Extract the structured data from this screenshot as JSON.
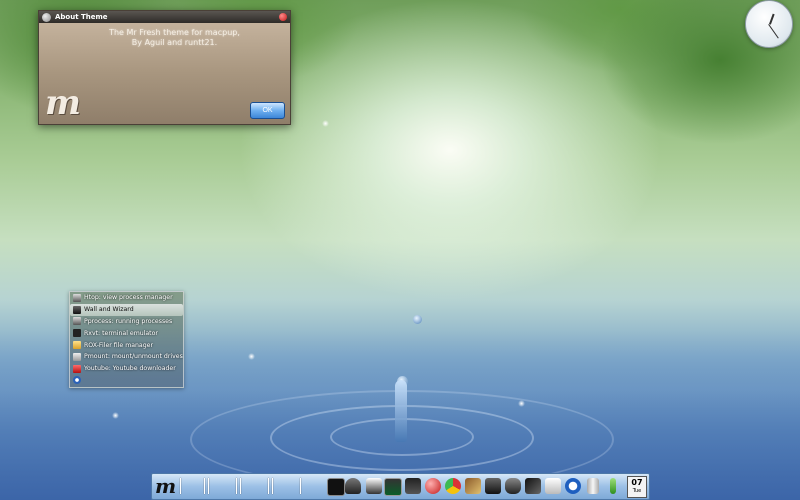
{
  "dialog": {
    "title": "About Theme",
    "message_line1": "The Mr Fresh theme for macpup,",
    "message_line2": "By Aguil and runtt21.",
    "logo_glyph": "m",
    "ok_label": "OK"
  },
  "launcher": {
    "items": [
      {
        "label": "Htop: view process manager",
        "icon": "htop-icon"
      },
      {
        "label": "Wall and Wizard",
        "icon": "wizard-icon"
      },
      {
        "label": "Pprocess: running processes",
        "icon": "process-icon"
      },
      {
        "label": "Rxvt: terminal emulator",
        "icon": "terminal-icon"
      },
      {
        "label": "ROX-Filer file manager",
        "icon": "folder-icon"
      },
      {
        "label": "Pmount: mount/unmount drives",
        "icon": "drive-icon"
      },
      {
        "label": "Youtube: Youtube downloader",
        "icon": "youtube-icon"
      },
      {
        "label": "",
        "icon": "power-icon"
      }
    ]
  },
  "taskbar": {
    "logo_glyph": "m",
    "date_day": "07",
    "date_weekday": "Tue",
    "tray_icons": [
      "terminal-icon",
      "hand-icon",
      "printer-icon",
      "monitor-icon",
      "graduation-icon",
      "globe-icon",
      "chrome-icon",
      "broom-icon",
      "camera-icon",
      "car-icon",
      "x-tools-icon",
      "write-icon",
      "power-icon",
      "trash-icon",
      "pencil-icon"
    ]
  },
  "colors": {
    "dock_top": "#d7e7f7",
    "dock_bottom": "#7ea9d7",
    "ok_button": "#3c86d8",
    "close_button": "#c01818"
  }
}
